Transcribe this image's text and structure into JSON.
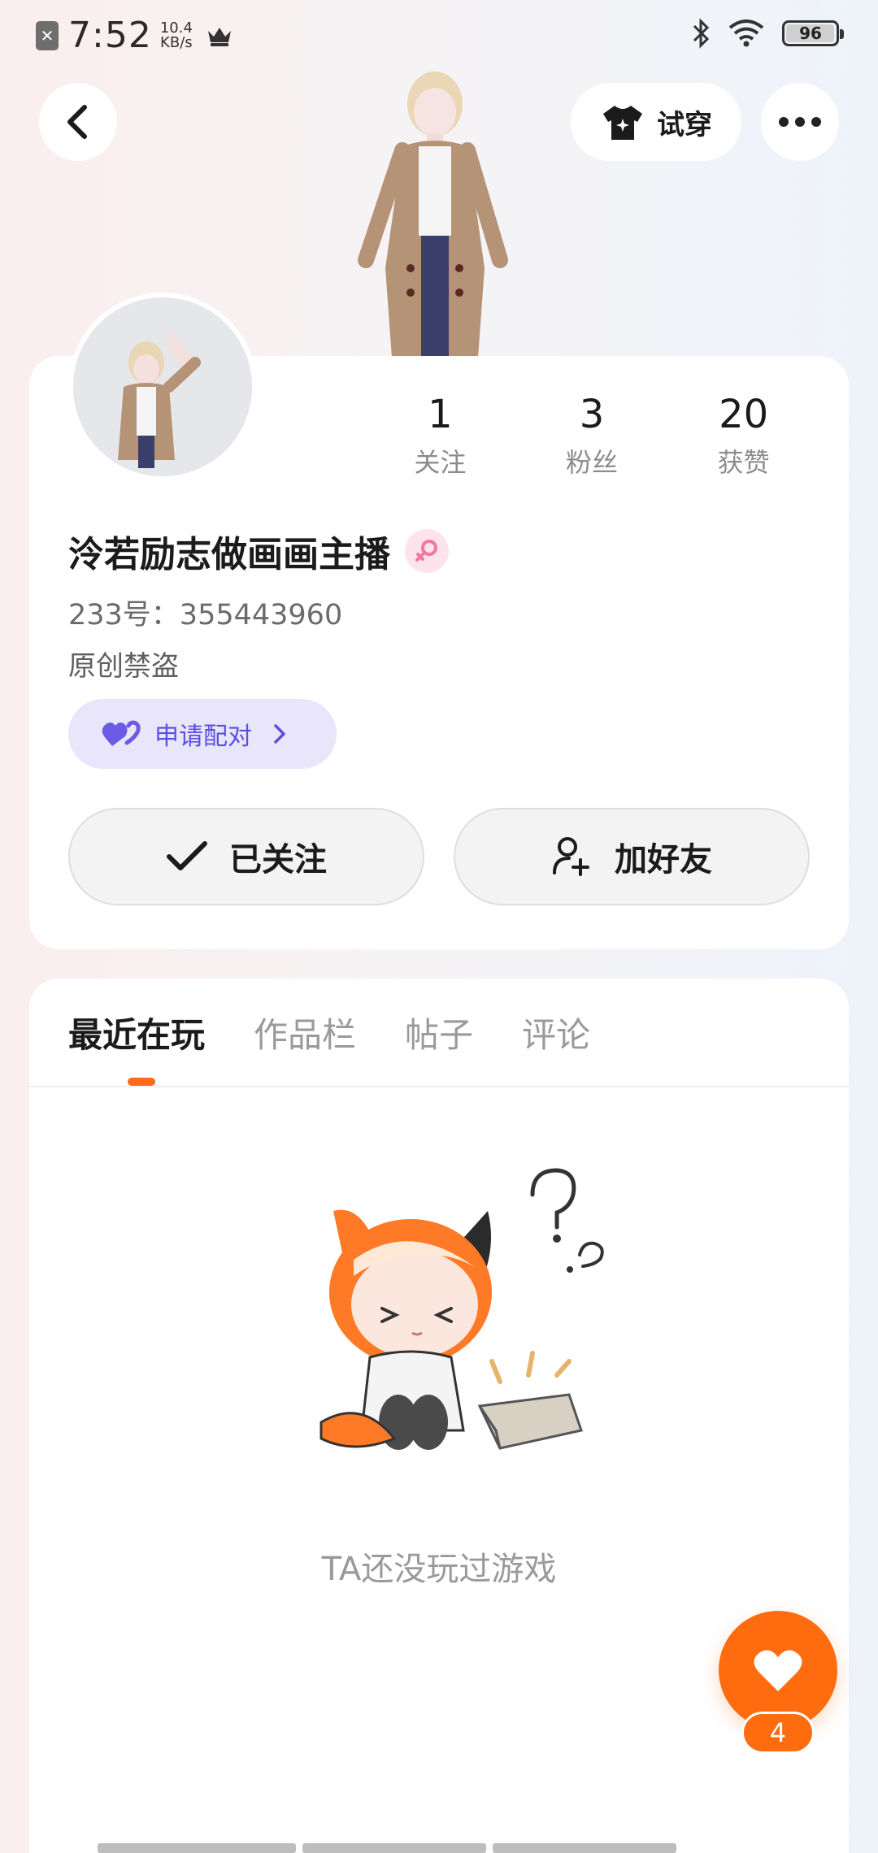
{
  "status_bar": {
    "time": "7:52",
    "net_speed": "10.4",
    "net_unit": "KB/s",
    "battery": "96",
    "battery_level": 0.96
  },
  "header": {
    "try_on_label": "试穿"
  },
  "profile": {
    "name": "泠若励志做画画主播",
    "uid": "233号：355443960",
    "bio": "原创禁盗",
    "pair_label": "申请配对",
    "stats": [
      {
        "value": "1",
        "label": "关注"
      },
      {
        "value": "3",
        "label": "粉丝"
      },
      {
        "value": "20",
        "label": "获赞"
      }
    ],
    "follow_label": "已关注",
    "add_friend_label": "加好友"
  },
  "tabs": [
    {
      "label": "最近在玩",
      "active": true
    },
    {
      "label": "作品栏",
      "active": false
    },
    {
      "label": "帖子",
      "active": false
    },
    {
      "label": "评论",
      "active": false
    }
  ],
  "empty_state": {
    "text": "TA还没玩过游戏"
  },
  "like": {
    "count": "4"
  },
  "colors": {
    "accent": "#ff6b0f",
    "pair_bg": "#e9e6fb",
    "pair_text": "#5b4fe0",
    "gender_bg": "#fde3ec"
  }
}
